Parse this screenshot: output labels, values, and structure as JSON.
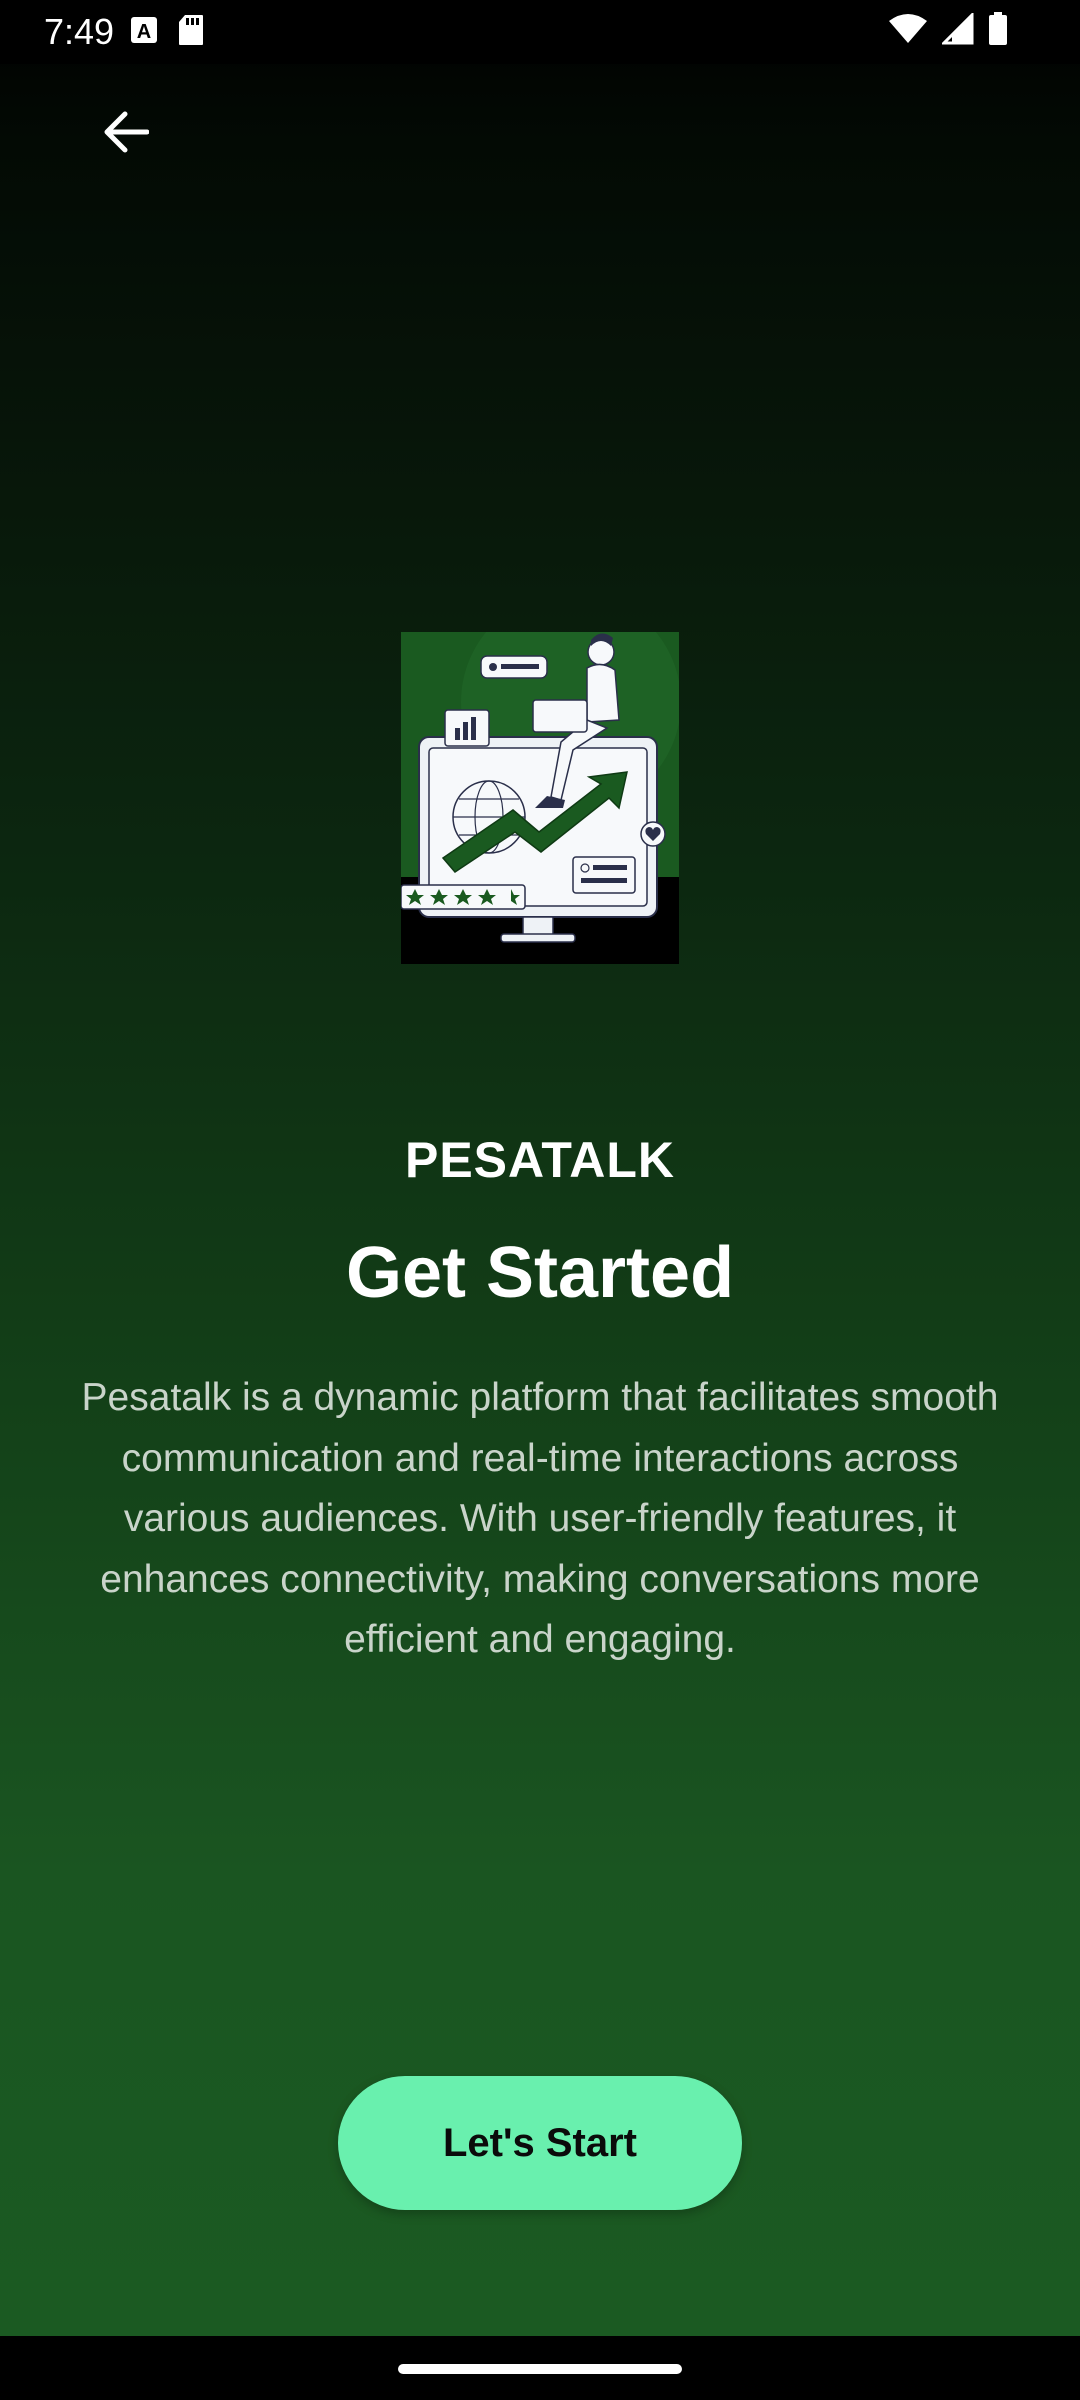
{
  "status_bar": {
    "time": "7:49",
    "left_icons": [
      "a-notification-icon",
      "sd-card-icon"
    ],
    "right_icons": [
      "wifi-icon",
      "signal-icon",
      "battery-icon"
    ]
  },
  "navigation": {
    "back_icon": "arrow-left-icon"
  },
  "hero": {
    "icon": "growth-analytics-illustration"
  },
  "content": {
    "brand": "PESATALK",
    "title": "Get Started",
    "description": "Pesatalk is a dynamic platform that facilitates smooth communication and real-time interactions across various audiences. With user-friendly features, it enhances connectivity, making conversations more efficient and engaging."
  },
  "actions": {
    "start_label": "Let's Start"
  },
  "colors": {
    "accent": "#69f0ae",
    "background_top": "#000000",
    "background_bottom": "#1b5b22",
    "illustration_green": "#1a5a20"
  }
}
